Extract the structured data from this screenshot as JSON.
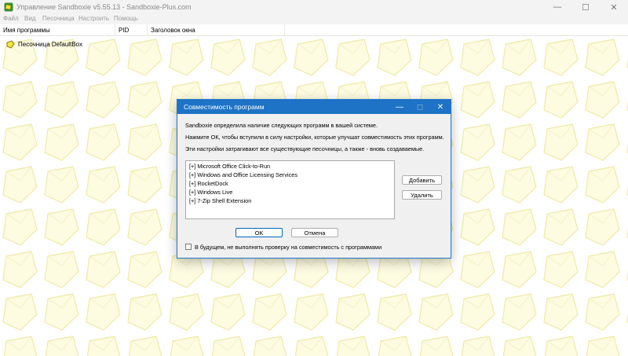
{
  "window": {
    "title": "Управление Sandboxie v5.55.13 - Sandboxie-Plus.com",
    "minimize_glyph": "—",
    "maximize_glyph": "☐",
    "close_glyph": "✕"
  },
  "menu": {
    "items": [
      "Файл",
      "Вид",
      "Песочница",
      "Настроить",
      "Помощь"
    ]
  },
  "columns": {
    "program_name": "Имя программы",
    "pid": "PID",
    "window_title": "Заголовок окна"
  },
  "tree": {
    "sandbox_label": "Песочница DefaultBox"
  },
  "dialog": {
    "title": "Совместимость программ",
    "minimize_glyph": "—",
    "maximize_glyph": "◻",
    "close_glyph": "✕",
    "line1": "Sandboxie определила наличие следующих программ в вашей системе.",
    "line2": "Нажмите ОК, чтобы вступили в силу настройки, которые улучшат совместимость этих программ.",
    "line3": "Эти настройки затрагивают все существующие песочницы, а также - вновь создаваемые.",
    "programs": [
      "[+]  Microsoft Office Click-to-Run",
      "[+]  Windows and Office Licensing Services",
      "[+]  RocketDock",
      "[+]  Windows Live",
      "[+]  7-Zip Shell Extension"
    ],
    "add_label": "Добавить",
    "remove_label": "Удалить",
    "ok_label": "OK",
    "cancel_label": "Отмена",
    "checkbox_label": "В будущем, не выполнять проверку на совместимость с программами",
    "checkbox_checked": false
  },
  "colors": {
    "dialog_accent": "#1e73c6",
    "pattern_fill": "#fdfbe0",
    "pattern_stroke": "#eeeaa8",
    "sandbox_icon": "#f4e43a"
  }
}
